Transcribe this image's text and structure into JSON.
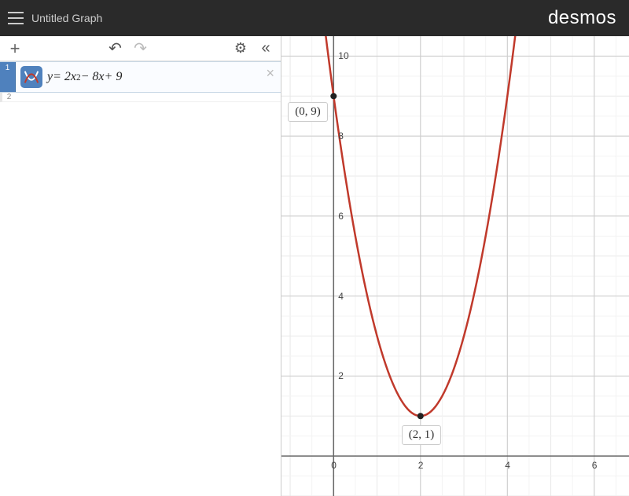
{
  "header": {
    "title": "Untitled Graph",
    "brand": "desmos"
  },
  "toolbar": {
    "add_label": "+",
    "undo_label": "↶",
    "redo_label": "↷",
    "settings_label": "⚙",
    "collapse_label": "«"
  },
  "expressions": [
    {
      "index": "1",
      "formula_html": "<i>y</i> = 2<i>x</i><sup>2</sup> − 8<i>x</i> + 9",
      "color": "#c0392b"
    }
  ],
  "graph": {
    "x_range": [
      -1.2,
      6.8
    ],
    "y_range": [
      -1.0,
      10.5
    ],
    "x_ticks": [
      0,
      2,
      4,
      6
    ],
    "y_ticks": [
      2,
      4,
      6,
      8,
      10
    ],
    "points": [
      {
        "x": 0,
        "y": 9,
        "label": "(0, 9)",
        "label_pos": "left-below"
      },
      {
        "x": 2,
        "y": 1,
        "label": "(2, 1)",
        "label_pos": "below"
      }
    ]
  },
  "chart_data": {
    "type": "line",
    "title": "",
    "xlabel": "",
    "ylabel": "",
    "xlim": [
      -1.2,
      6.8
    ],
    "ylim": [
      -1.0,
      10.5
    ],
    "grid": true,
    "series": [
      {
        "name": "y = 2x² − 8x + 9",
        "color": "#c0392b",
        "points": [
          {
            "x": -0.2,
            "y": 10.68
          },
          {
            "x": 0.0,
            "y": 9.0
          },
          {
            "x": 0.5,
            "y": 5.5
          },
          {
            "x": 1.0,
            "y": 3.0
          },
          {
            "x": 1.5,
            "y": 1.5
          },
          {
            "x": 2.0,
            "y": 1.0
          },
          {
            "x": 2.5,
            "y": 1.5
          },
          {
            "x": 3.0,
            "y": 3.0
          },
          {
            "x": 3.5,
            "y": 5.5
          },
          {
            "x": 4.0,
            "y": 9.0
          },
          {
            "x": 4.2,
            "y": 10.68
          }
        ]
      }
    ],
    "annotations": [
      {
        "x": 0,
        "y": 9,
        "text": "(0, 9)"
      },
      {
        "x": 2,
        "y": 1,
        "text": "(2, 1)"
      }
    ]
  }
}
